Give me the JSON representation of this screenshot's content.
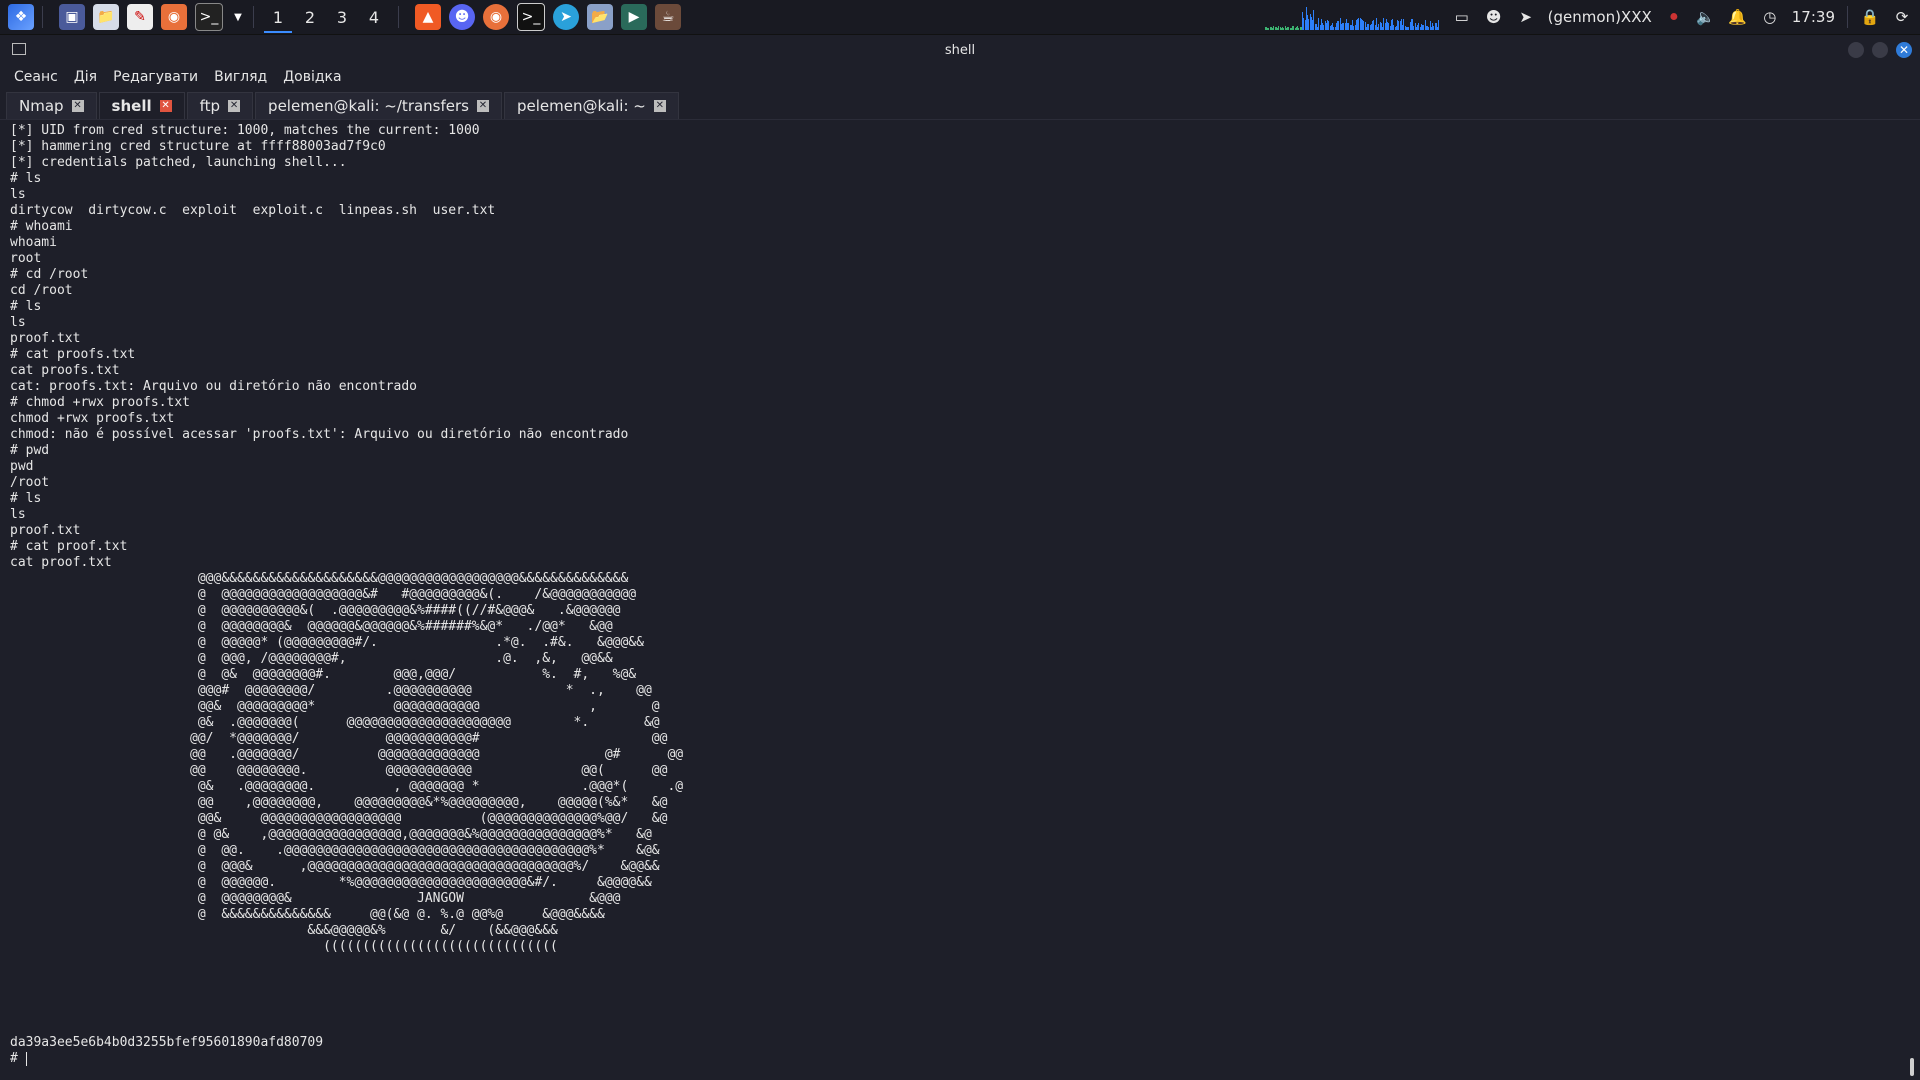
{
  "taskbar": {
    "workspaces": [
      "1",
      "2",
      "3",
      "4"
    ],
    "active_workspace": "1",
    "user_label": "(genmon)XXX",
    "clock": "17:39"
  },
  "window": {
    "title": "shell"
  },
  "menu": {
    "items": [
      "Сеанс",
      "Дія",
      "Редагувати",
      "Вигляд",
      "Довідка"
    ]
  },
  "tabs": [
    {
      "label": "Nmap",
      "active": false
    },
    {
      "label": "shell",
      "active": true
    },
    {
      "label": "ftp",
      "active": false
    },
    {
      "label": "pelemen@kali: ~/transfers",
      "active": false
    },
    {
      "label": "pelemen@kali: ~",
      "active": false
    }
  ],
  "terminal": {
    "lines": [
      "[*] UID from cred structure: 1000, matches the current: 1000",
      "[*] hammering cred structure at ffff88003ad7f9c0",
      "[*] credentials patched, launching shell...",
      "# ls",
      "ls",
      "dirtycow  dirtycow.c  exploit  exploit.c  linpeas.sh  user.txt",
      "# whoami",
      "whoami",
      "root",
      "# cd /root",
      "cd /root",
      "# ls",
      "ls",
      "proof.txt",
      "# cat proofs.txt",
      "cat proofs.txt",
      "cat: proofs.txt: Arquivo ou diretório não encontrado",
      "# chmod +rwx proofs.txt",
      "chmod +rwx proofs.txt",
      "chmod: não é possível acessar 'proofs.txt': Arquivo ou diretório não encontrado",
      "# pwd",
      "pwd",
      "/root",
      "# ls",
      "ls",
      "proof.txt",
      "# cat proof.txt",
      "cat proof.txt",
      "                        @@@&&&&&&&&&&&&&&&&&&&&@@@@@@@@@@@@@@@@@@&&&&&&&&&&&&&&",
      "                        @  @@@@@@@@@@@@@@@@@@&#   #@@@@@@@@@&(.    /&@@@@@@@@@@@",
      "                        @  @@@@@@@@@@&(  .@@@@@@@@@&%####((//#&@@@&   .&@@@@@@",
      "                        @  @@@@@@@@&  @@@@@@&@@@@@@&%######%&@*   ./@@*   &@@",
      "                        @  @@@@@* (@@@@@@@@@#/.               .*@.  .#&.   &@@@&&",
      "                        @  @@@, /@@@@@@@@#,                   .@.  ,&,   @@&&",
      "                        @  @&  @@@@@@@@#.        @@@,@@@/           %.  #,   %@&",
      "                        @@@#  @@@@@@@@/         .@@@@@@@@@@            *  .,    @@",
      "                        @@&  @@@@@@@@@*          @@@@@@@@@@@              ,       @",
      "                        @&  .@@@@@@@(      @@@@@@@@@@@@@@@@@@@@@        *.       &@",
      "                       @@/  *@@@@@@@/           @@@@@@@@@@@#                      @@",
      "                       @@   .@@@@@@@/          @@@@@@@@@@@@@                @#      @@",
      "                       @@    @@@@@@@@.          @@@@@@@@@@@              @@(      @@",
      "                        @&   .@@@@@@@@.          , @@@@@@@ *             .@@@*(     .@",
      "                        @@    ,@@@@@@@@,    @@@@@@@@@&*%@@@@@@@@@,    @@@@@(%&*   &@",
      "                        @@&     @@@@@@@@@@@@@@@@@@          (@@@@@@@@@@@@@@%@@/   &@",
      "                        @ @&    ,@@@@@@@@@@@@@@@@@,@@@@@@@&%@@@@@@@@@@@@@@@%*   &@",
      "                        @  @@.    .@@@@@@@@@@@@@@@@@@@@@@@@@@@@@@@@@@@@@@@%*    &@&",
      "                        @  @@@&      ,@@@@@@@@@@@@@@@@@@@@@@@@@@@@@@@@@@%/    &@@&&",
      "                        @  @@@@@@.        *%@@@@@@@@@@@@@@@@@@@@@@&#/.     &@@@@&&",
      "                        @  @@@@@@@@&                JANGOW                &@@@",
      "                        @  &&&&&&&&&&&&&&     @@(&@ @. %.@ @@%@     &@@@&&&&",
      "                                      &&&@@@@@&%       &/    (&&@@@&&&",
      "                                        ((((((((((((((((((((((((((((((",
      "",
      "",
      "",
      "",
      "",
      "da39a3ee5e6b4b0d3255bfef95601890afd80709"
    ],
    "prompt": "# "
  }
}
